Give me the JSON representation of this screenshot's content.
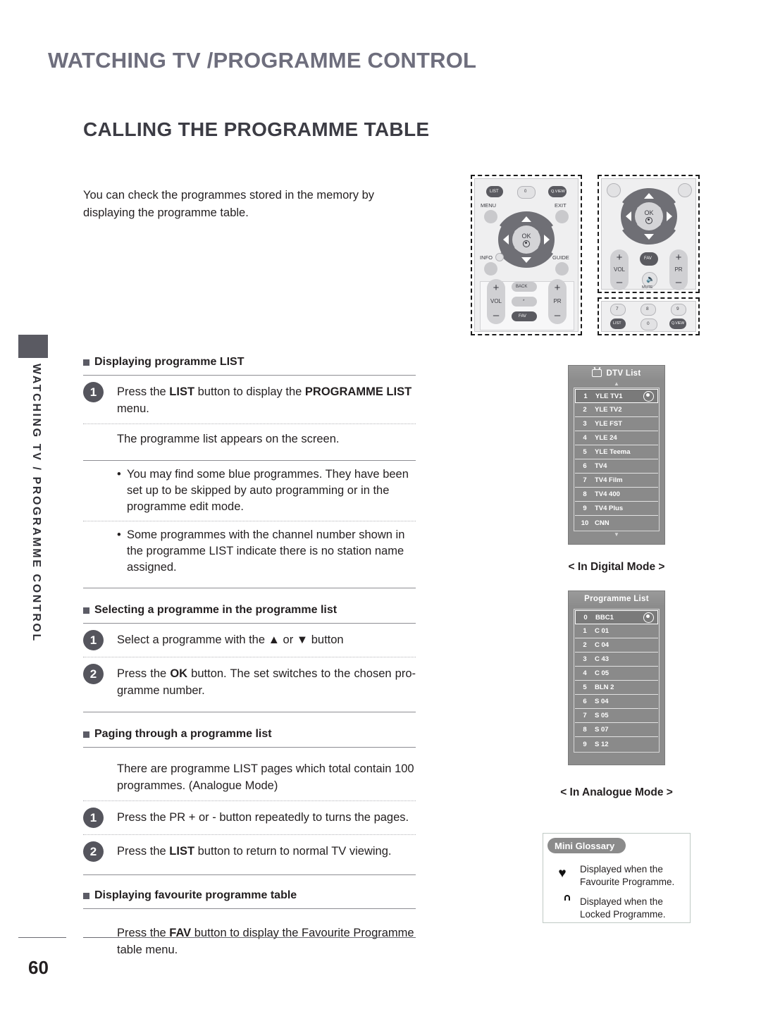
{
  "header": {
    "title": "WATCHING TV /PROGRAMME CONTROL",
    "subtitle": "CALLING THE PROGRAMME TABLE",
    "side_tab_text": "WATCHING TV / PROGRAMME CONTROL",
    "page_number": "60"
  },
  "intro": {
    "text": "You can check the programmes stored in the memory by displaying the programme table."
  },
  "sections": {
    "displaying_list": {
      "heading": "Displaying programme LIST",
      "step1_badge": "1",
      "step1_part_a": "Press the ",
      "step1_bold_a": "LIST",
      "step1_part_b": " button to display the ",
      "step1_bold_b": "PROGRAMME LIST",
      "step1_part_c": " menu.",
      "note": "The programme list appears on the screen.",
      "bullet1": "You may find some blue programmes. They have been set up to be skipped by auto programming or in the programme edit mode.",
      "bullet2": "Some programmes with the channel number shown in the programme LIST indicate there is no station name assigned."
    },
    "selecting": {
      "heading": "Selecting a programme in the programme list",
      "step1_badge": "1",
      "step1_part_a": "Select a programme with the ",
      "step1_up_arrow": "▲",
      "step1_or": " or ",
      "step1_down_arrow": "▼",
      "step1_part_b": " button",
      "step2_badge": "2",
      "step2_part_a": "Press the ",
      "step2_bold": "OK",
      "step2_part_b": " button. The set switches to the chosen pro-gramme number."
    },
    "paging": {
      "heading": "Paging through a programme list",
      "note": "There are programme LIST pages which total contain 100 programmes. (Analogue Mode)",
      "step1_badge": "1",
      "step1_text": "Press the PR + or - button repeatedly to turns the pages.",
      "step2_badge": "2",
      "step2_part_a": "Press the ",
      "step2_bold": "LIST",
      "step2_part_b": " button to return to normal TV viewing."
    },
    "favourite": {
      "heading": "Displaying favourite programme table",
      "note_part_a": "Press the ",
      "note_bold": "FAV",
      "note_part_b": " button to display the Favourite Programme table menu."
    }
  },
  "remote_primary": {
    "top_buttons": [
      "LIST",
      "0",
      "Q.VIEW"
    ],
    "menu_label": "MENU",
    "exit_label": "EXIT",
    "info_label": "INFO",
    "guide_label": "GUIDE",
    "ok_label": "OK",
    "vol_label": "VOL",
    "pr_label": "PR",
    "back_label": "BACK",
    "fav_label": "FAV",
    "plus": "+",
    "minus": "–"
  },
  "remote_secondary": {
    "ok_label": "OK",
    "vol_label": "VOL",
    "pr_label": "PR",
    "fav_label": "FAV",
    "mute_label": "MUTE",
    "plus": "+",
    "minus": "–",
    "numpad": [
      "7",
      "8",
      "9"
    ],
    "bottom_buttons": [
      "LIST",
      "0",
      "Q.VIEW"
    ]
  },
  "dtv_list": {
    "title": "DTV List",
    "title_icon": "tv-icon",
    "scroll_up": "▲",
    "scroll_down": "▼",
    "rows": [
      {
        "num": "1",
        "name": "YLE TV1",
        "selected": true,
        "mark": true
      },
      {
        "num": "2",
        "name": "YLE TV2",
        "selected": false,
        "mark": false
      },
      {
        "num": "3",
        "name": "YLE FST",
        "selected": false,
        "mark": false
      },
      {
        "num": "4",
        "name": "YLE 24",
        "selected": false,
        "mark": false
      },
      {
        "num": "5",
        "name": "YLE Teema",
        "selected": false,
        "mark": false
      },
      {
        "num": "6",
        "name": "TV4",
        "selected": false,
        "mark": false
      },
      {
        "num": "7",
        "name": "TV4 Film",
        "selected": false,
        "mark": false
      },
      {
        "num": "8",
        "name": "TV4 400",
        "selected": false,
        "mark": false
      },
      {
        "num": "9",
        "name": "TV4 Plus",
        "selected": false,
        "mark": false
      },
      {
        "num": "10",
        "name": "CNN",
        "selected": false,
        "mark": false
      }
    ],
    "caption": "< In Digital Mode >"
  },
  "programme_list": {
    "title": "Programme List",
    "rows": [
      {
        "num": "0",
        "name": "BBC1",
        "selected": true,
        "mark": true
      },
      {
        "num": "1",
        "name": "C 01",
        "selected": false,
        "mark": false
      },
      {
        "num": "2",
        "name": "C 04",
        "selected": false,
        "mark": false
      },
      {
        "num": "3",
        "name": "C 43",
        "selected": false,
        "mark": false
      },
      {
        "num": "4",
        "name": "C 05",
        "selected": false,
        "mark": false
      },
      {
        "num": "5",
        "name": "BLN 2",
        "selected": false,
        "mark": false
      },
      {
        "num": "6",
        "name": "S 04",
        "selected": false,
        "mark": false
      },
      {
        "num": "7",
        "name": "S 05",
        "selected": false,
        "mark": false
      },
      {
        "num": "8",
        "name": "S 07",
        "selected": false,
        "mark": false
      },
      {
        "num": "9",
        "name": "S 12",
        "selected": false,
        "mark": false
      }
    ],
    "caption": "< In Analogue Mode >"
  },
  "glossary": {
    "tab_label": "Mini Glossary",
    "items": [
      {
        "icon": "heart-icon",
        "glyph": "♥",
        "text": "Displayed when the Favourite Programme."
      },
      {
        "icon": "lock-icon",
        "glyph": "",
        "text": "Displayed when the Locked Programme."
      }
    ]
  },
  "colors": {
    "header_blue_gray": "#6e6e7d",
    "badge_gray": "#55555d",
    "osd_gray": "#8c8c8c",
    "glossary_border": "#bfc9c4"
  }
}
